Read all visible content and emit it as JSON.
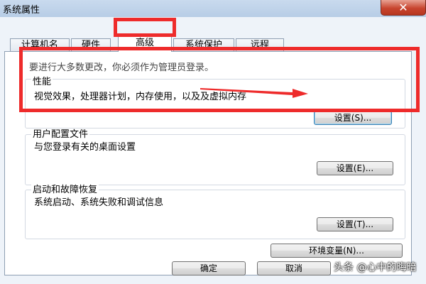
{
  "window": {
    "title": "系统属性",
    "close_icon": "✕"
  },
  "tabs": [
    {
      "label": "计算机名"
    },
    {
      "label": "硬件"
    },
    {
      "label": "高级"
    },
    {
      "label": "系统保护"
    },
    {
      "label": "远程"
    }
  ],
  "advanced": {
    "notice": "要进行大多数更改，你必须作为管理员登录。",
    "performance": {
      "title": "性能",
      "description": "视觉效果，处理器计划，内存使用，以及及虚拟内存",
      "button": "设置(S)..."
    },
    "user_profiles": {
      "title": "用户配置文件",
      "description": "与您登录有关的桌面设置",
      "button": "设置(E)..."
    },
    "startup_recovery": {
      "title": "启动和故障恢复",
      "description": "系统启动、系统失败和调试信息",
      "button": "设置(T)..."
    },
    "env_button": "环境变量(N)..."
  },
  "footer": {
    "ok": "确定",
    "cancel": "取消"
  },
  "watermark": "头条 @心中的晦暗",
  "colors": {
    "highlight": "#ee2b2b",
    "accent": "#3c7fb1"
  }
}
